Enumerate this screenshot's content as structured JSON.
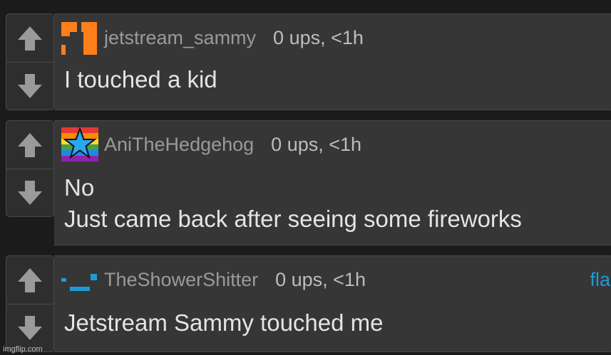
{
  "comments": [
    {
      "username": "jetstream_sammy",
      "points": "0 ups, <1h",
      "avatar_icon": "orange-blocks-icon",
      "text_lines": [
        "I touched a kid"
      ]
    },
    {
      "username": "AniTheHedgehog",
      "points": "0 ups, <1h",
      "avatar_icon": "rainbow-star-icon",
      "text_lines": [
        "No",
        "Just came back after seeing some fireworks"
      ]
    },
    {
      "username": "TheShowerShitter",
      "points": "0 ups, <1h",
      "avatar_icon": "blue-shapes-icon",
      "flag_label": "fla",
      "text_lines": [
        "Jetstream Sammy touched me"
      ]
    }
  ],
  "icons": {
    "upvote": "arrow-up-icon",
    "downvote": "arrow-down-icon"
  },
  "colors": {
    "background": "#1b1b1b",
    "panel": "#363636",
    "link": "#1e9bd6",
    "avatar1": "#ff7f1a"
  },
  "watermark": "imgflip.com"
}
